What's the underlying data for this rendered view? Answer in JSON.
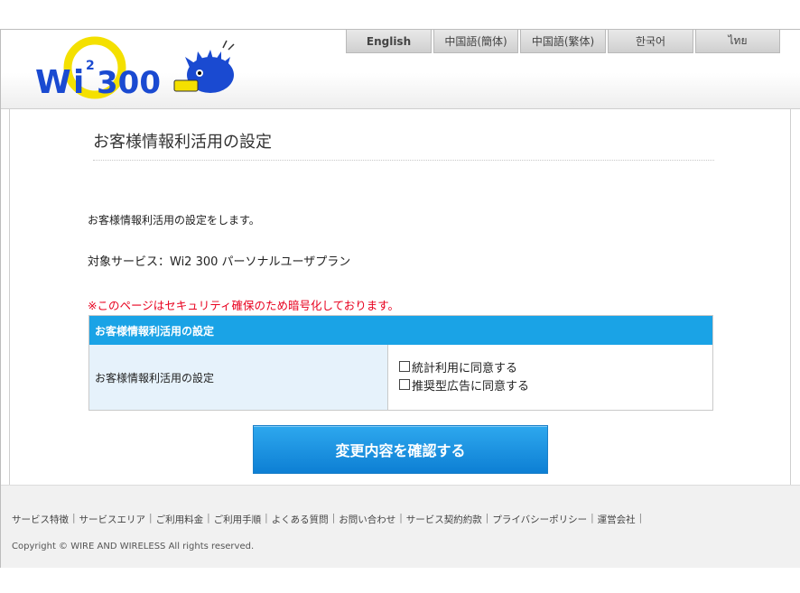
{
  "languages": [
    "English",
    "中国語(簡体)",
    "中国語(繁体)",
    "한국어",
    "ไทย"
  ],
  "logo": {
    "text": "Wi2 300",
    "color_blue": "#1a4ad1",
    "color_yellow": "#f4e000"
  },
  "page": {
    "title": "お客様情報利活用の設定",
    "intro": "お客様情報利活用の設定をします。",
    "service": "対象サービス：Wi2 300 パーソナルユーザプラン",
    "notice": "※このページはセキュリティ確保のため暗号化しております。"
  },
  "settings": {
    "header": "お客様情報利活用の設定",
    "label": "お客様情報利活用の設定",
    "options": [
      "統計利用に同意する",
      "推奨型広告に同意する"
    ]
  },
  "confirm_button": "変更内容を確認する",
  "footer": {
    "links": [
      "サービス特徴",
      "サービスエリア",
      "ご利用料金",
      "ご利用手順",
      "よくある質問",
      "お問い合わせ",
      "サービス契約約款",
      "プライバシーポリシー",
      "運営会社"
    ],
    "copyright": "Copyright © WIRE AND WIRELESS All rights reserved."
  },
  "colors": {
    "accent": "#1aa3e6",
    "notice": "#e8001e"
  }
}
